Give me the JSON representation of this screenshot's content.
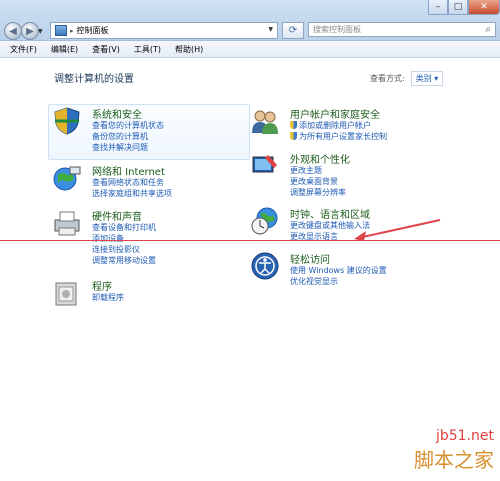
{
  "window": {
    "minimize_icon": "minimize-icon",
    "maximize_icon": "maximize-icon",
    "close_icon": "close-icon"
  },
  "address": {
    "crumb": "控制面板",
    "separator": "▸"
  },
  "search": {
    "placeholder": "搜索控制面板"
  },
  "menu": [
    "文件(F)",
    "编辑(E)",
    "查看(V)",
    "工具(T)",
    "帮助(H)"
  ],
  "main": {
    "title": "调整计算机的设置",
    "view_by_label": "查看方式:",
    "view_by_value": "类别 ▾"
  },
  "categories": [
    {
      "title": "系统和安全",
      "links": [
        "查看您的计算机状态",
        "备份您的计算机",
        "查找并解决问题"
      ]
    },
    {
      "title": "网络和 Internet",
      "links": [
        "查看网络状态和任务",
        "选择家庭组和共享选项"
      ]
    },
    {
      "title": "硬件和声音",
      "links": [
        "查看设备和打印机",
        "添加设备",
        "连接到投影仪",
        "调整常用移动设置"
      ]
    },
    {
      "title": "程序",
      "links": [
        "卸载程序"
      ]
    },
    {
      "title": "用户帐户和家庭安全",
      "links": [
        "添加或删除用户帐户",
        "为所有用户设置家长控制"
      ]
    },
    {
      "title": "外观和个性化",
      "links": [
        "更改主题",
        "更改桌面背景",
        "调整屏幕分辨率"
      ]
    },
    {
      "title": "时钟、语言和区域",
      "links": [
        "更改键盘或其他输入法",
        "更改显示语言"
      ]
    },
    {
      "title": "轻松访问",
      "links": [
        "使用 Windows 建议的设置",
        "优化视觉显示"
      ]
    }
  ],
  "watermark": {
    "url": "jb51.net",
    "name": "脚本之家"
  },
  "colors": {
    "link": "#1d5ab4",
    "category_title": "#1e5d1e",
    "annotation": "#e0454c"
  }
}
